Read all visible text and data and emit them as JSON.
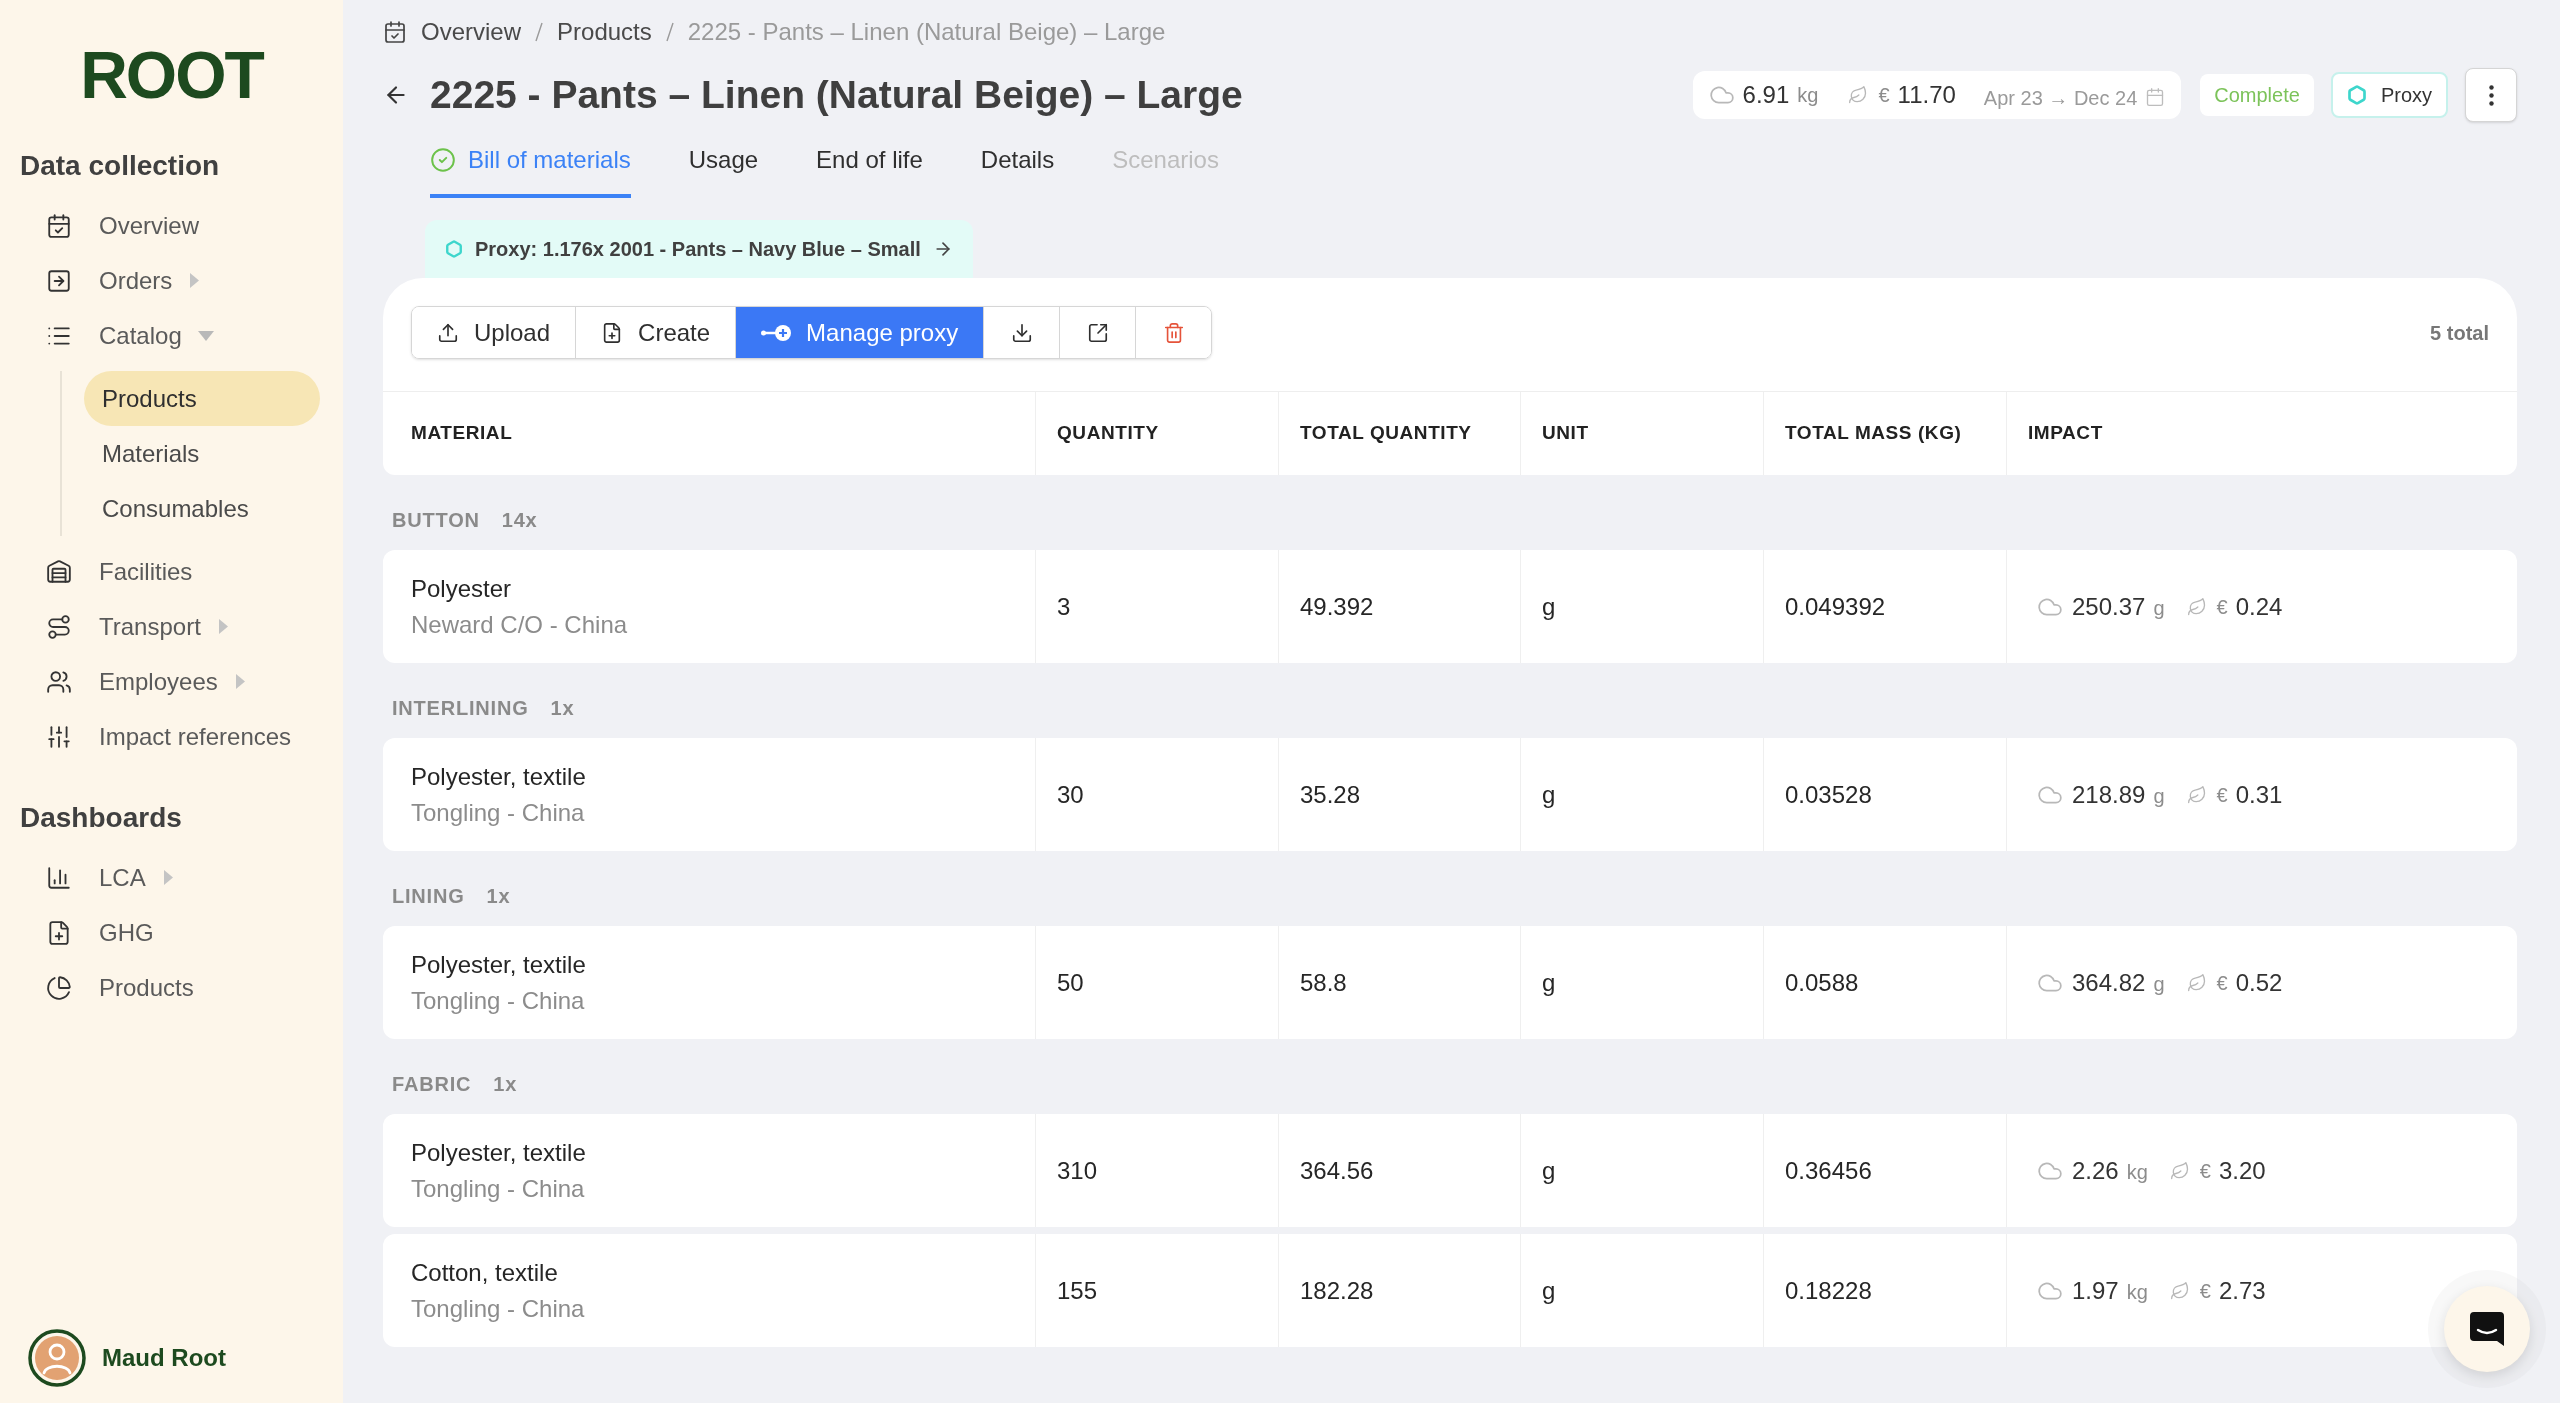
{
  "sidebar": {
    "logo": "ROOT",
    "sections": [
      {
        "title": "Data collection",
        "items": [
          {
            "label": "Overview",
            "selected": false
          },
          {
            "label": "Orders",
            "selected": false,
            "expanded": false
          },
          {
            "label": "Catalog",
            "selected": false,
            "expanded": true,
            "children": [
              {
                "label": "Products",
                "selected": true
              },
              {
                "label": "Materials",
                "selected": false
              },
              {
                "label": "Consumables",
                "selected": false
              }
            ]
          },
          {
            "label": "Facilities",
            "selected": false
          },
          {
            "label": "Transport",
            "selected": false,
            "expanded": false
          },
          {
            "label": "Employees",
            "selected": false,
            "expanded": false
          },
          {
            "label": "Impact references",
            "selected": false
          }
        ]
      },
      {
        "title": "Dashboards",
        "items": [
          {
            "label": "LCA",
            "selected": false,
            "expanded": false
          },
          {
            "label": "GHG",
            "selected": false
          },
          {
            "label": "Products",
            "selected": false
          }
        ]
      }
    ],
    "user": {
      "name": "Maud Root"
    }
  },
  "breadcrumb": [
    "Overview",
    "Products",
    "2225 - Pants – Linen (Natural Beige) – Large"
  ],
  "header": {
    "title": "2225 - Pants – Linen (Natural Beige) – Large",
    "summary": {
      "co2": "6.91",
      "co2_unit": "kg",
      "currency": "€",
      "cost": "11.70",
      "period": "Apr 23 → Dec 24"
    },
    "status": "Complete",
    "proxy_button": "Proxy"
  },
  "tabs": [
    {
      "label": "Bill of materials",
      "selected": true,
      "complete": true,
      "disabled": false
    },
    {
      "label": "Usage",
      "selected": false,
      "complete": false,
      "disabled": false
    },
    {
      "label": "End of life",
      "selected": false,
      "complete": false,
      "disabled": false
    },
    {
      "label": "Details",
      "selected": false,
      "complete": false,
      "disabled": false
    },
    {
      "label": "Scenarios",
      "selected": false,
      "complete": false,
      "disabled": true
    }
  ],
  "proxy_banner": "Proxy: 1.176x 2001 - Pants – Navy Blue – Small",
  "toolbar": {
    "buttons": [
      {
        "label": "Upload",
        "active": false
      },
      {
        "label": "Create",
        "active": false
      },
      {
        "label": "Manage proxy",
        "active": true
      }
    ],
    "total": "5 total"
  },
  "table": {
    "columns": [
      "MATERIAL",
      "QUANTITY",
      "TOTAL QUANTITY",
      "UNIT",
      "TOTAL MASS (KG)",
      "IMPACT"
    ],
    "groups": [
      {
        "name": "BUTTON",
        "count": "14x",
        "rows": [
          {
            "material": "Polyester",
            "supplier": "Neward C/O - China",
            "quantity": "3",
            "total_quantity": "49.392",
            "unit": "g",
            "total_mass": "0.049392",
            "impact": {
              "co2": "250.37",
              "co2_unit": "g",
              "currency": "€",
              "cost": "0.24"
            }
          }
        ]
      },
      {
        "name": "INTERLINING",
        "count": "1x",
        "rows": [
          {
            "material": "Polyester, textile",
            "supplier": "Tongling - China",
            "quantity": "30",
            "total_quantity": "35.28",
            "unit": "g",
            "total_mass": "0.03528",
            "impact": {
              "co2": "218.89",
              "co2_unit": "g",
              "currency": "€",
              "cost": "0.31"
            }
          }
        ]
      },
      {
        "name": "LINING",
        "count": "1x",
        "rows": [
          {
            "material": "Polyester, textile",
            "supplier": "Tongling - China",
            "quantity": "50",
            "total_quantity": "58.8",
            "unit": "g",
            "total_mass": "0.0588",
            "impact": {
              "co2": "364.82",
              "co2_unit": "g",
              "currency": "€",
              "cost": "0.52"
            }
          }
        ]
      },
      {
        "name": "FABRIC",
        "count": "1x",
        "rows": [
          {
            "material": "Polyester, textile",
            "supplier": "Tongling - China",
            "quantity": "310",
            "total_quantity": "364.56",
            "unit": "g",
            "total_mass": "0.36456",
            "impact": {
              "co2": "2.26",
              "co2_unit": "kg",
              "currency": "€",
              "cost": "3.20"
            }
          },
          {
            "material": "Cotton, textile",
            "supplier": "Tongling - China",
            "quantity": "155",
            "total_quantity": "182.28",
            "unit": "g",
            "total_mass": "0.18228",
            "impact": {
              "co2": "1.97",
              "co2_unit": "kg",
              "currency": "€",
              "cost": "2.73"
            }
          }
        ]
      }
    ]
  }
}
